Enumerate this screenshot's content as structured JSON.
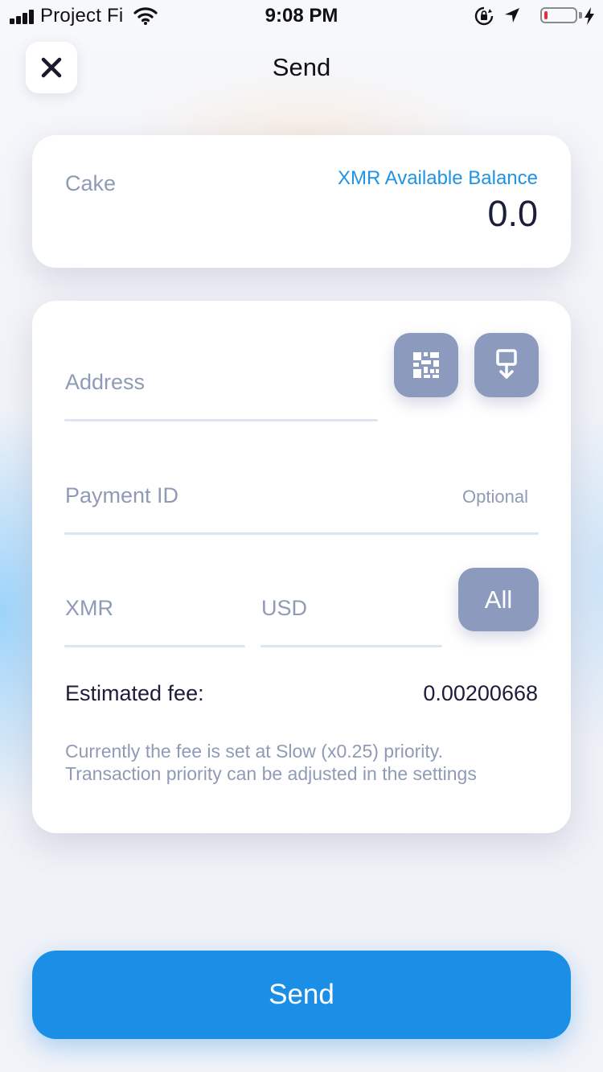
{
  "status_bar": {
    "carrier": "Project Fi",
    "time": "9:08 PM",
    "battery_level": 0.1,
    "icons": [
      "signal-icon",
      "wifi-icon",
      "orientation-lock-icon",
      "location-arrow-icon",
      "battery-icon",
      "charging-bolt-icon"
    ]
  },
  "header": {
    "title": "Send",
    "close_icon": "close-icon"
  },
  "wallet": {
    "name": "Cake",
    "balance_label": "XMR Available Balance",
    "balance_value": "0.0"
  },
  "form": {
    "address_placeholder": "Address",
    "qr_icon": "qr-code-icon",
    "address_book_icon": "address-book-download-icon",
    "payment_id_placeholder": "Payment ID",
    "payment_id_hint": "Optional",
    "xmr_placeholder": "XMR",
    "usd_placeholder": "USD",
    "all_label": "All",
    "fee_label": "Estimated fee:",
    "fee_value": "0.00200668",
    "fee_note_line1": "Currently the fee is set at Slow (x0.25) priority.",
    "fee_note_line2": "Transaction priority can be adjusted in the settings"
  },
  "actions": {
    "send_label": "Send"
  },
  "colors": {
    "accent": "#1b8fe6",
    "muted_button": "#8c9bbd",
    "label_text": "#8f9bb6",
    "dark_text": "#1c1d3a"
  }
}
